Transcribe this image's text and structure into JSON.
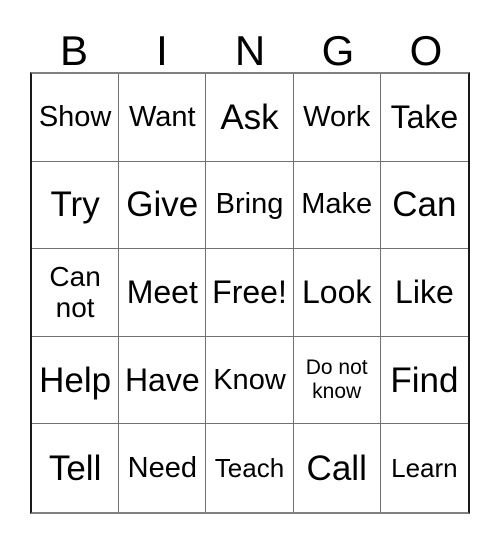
{
  "card": {
    "title": "BINGO Card",
    "header_letters": [
      "B",
      "I",
      "N",
      "G",
      "O"
    ],
    "grid_size": "5x5",
    "free_space": "Free!",
    "colors": {
      "background": "#ffffff",
      "text": "#000000",
      "grid_line": "#707070",
      "grid_border": "#1a1a1a"
    },
    "rows": [
      [
        {
          "label": "Show",
          "size": "md"
        },
        {
          "label": "Want",
          "size": "md"
        },
        {
          "label": "Ask",
          "size": "xl"
        },
        {
          "label": "Work",
          "size": "md"
        },
        {
          "label": "Take",
          "size": "lg"
        }
      ],
      [
        {
          "label": "Try",
          "size": "xl"
        },
        {
          "label": "Give",
          "size": "xl"
        },
        {
          "label": "Bring",
          "size": "md"
        },
        {
          "label": "Make",
          "size": "md"
        },
        {
          "label": "Can",
          "size": "xl"
        }
      ],
      [
        {
          "label": "Can\nnot",
          "size": "two-lg"
        },
        {
          "label": "Meet",
          "size": "lg"
        },
        {
          "label": "Free!",
          "size": "lg"
        },
        {
          "label": "Look",
          "size": "lg"
        },
        {
          "label": "Like",
          "size": "lg"
        }
      ],
      [
        {
          "label": "Help",
          "size": "xl"
        },
        {
          "label": "Have",
          "size": "lg"
        },
        {
          "label": "Know",
          "size": "md"
        },
        {
          "label": "Do not\nknow",
          "size": "two-sm"
        },
        {
          "label": "Find",
          "size": "xl"
        }
      ],
      [
        {
          "label": "Tell",
          "size": "xl"
        },
        {
          "label": "Need",
          "size": "md"
        },
        {
          "label": "Teach",
          "size": "sm"
        },
        {
          "label": "Call",
          "size": "xl"
        },
        {
          "label": "Learn",
          "size": "sm"
        }
      ]
    ]
  }
}
